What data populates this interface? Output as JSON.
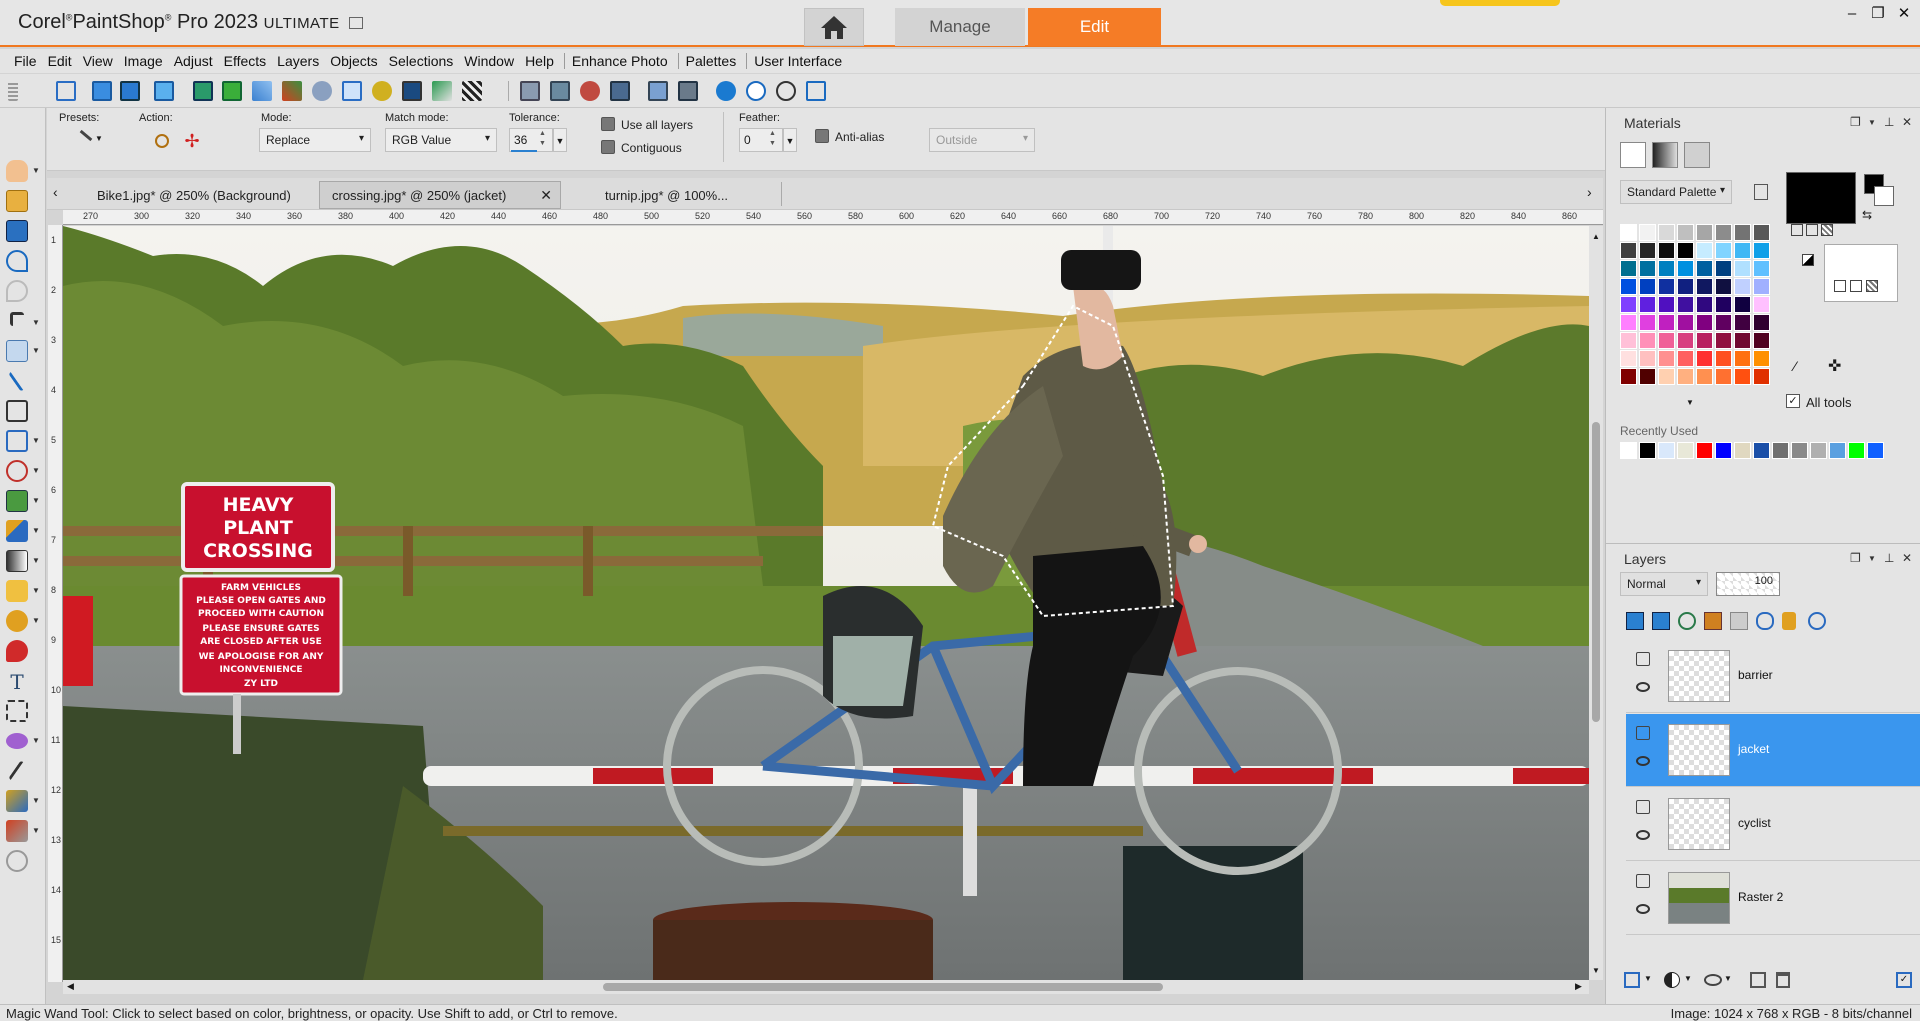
{
  "app": {
    "brand": "Corel",
    "name": "PaintShop",
    "name2": "Pro 2023",
    "edition": "ULTIMATE",
    "workspace_tabs": {
      "manage": "Manage",
      "edit": "Edit"
    }
  },
  "window_controls": {
    "minimize": "–",
    "restore": "❐",
    "close": "✕"
  },
  "menu": [
    "File",
    "Edit",
    "View",
    "Image",
    "Adjust",
    "Effects",
    "Layers",
    "Objects",
    "Selections",
    "Window",
    "Help"
  ],
  "menu_extra": [
    "Enhance Photo",
    "Palettes",
    "User Interface"
  ],
  "options": {
    "presets_label": "Presets:",
    "action_label": "Action:",
    "mode_label": "Mode:",
    "mode_value": "Replace",
    "match_mode_label": "Match mode:",
    "match_mode_value": "RGB Value",
    "tolerance_label": "Tolerance:",
    "tolerance_value": "36",
    "use_all_layers": "Use all layers",
    "contiguous": "Contiguous",
    "feather_label": "Feather:",
    "feather_value": "0",
    "anti_alias": "Anti-alias",
    "outside_value": "Outside"
  },
  "doc_tabs": [
    {
      "label": "Bike1.jpg* @ 250% (Background)"
    },
    {
      "label": "crossing.jpg* @ 250% (jacket)",
      "active": true
    },
    {
      "label": "turnip.jpg* @ 100%..."
    }
  ],
  "ruler_h": [
    "270",
    "300",
    "320",
    "340",
    "360",
    "380",
    "400",
    "420",
    "440",
    "460",
    "480",
    "500",
    "520",
    "540",
    "560",
    "580",
    "600",
    "620",
    "640",
    "660",
    "680",
    "700",
    "720",
    "740",
    "760",
    "780",
    "800",
    "820",
    "840",
    "860"
  ],
  "ruler_v": [
    "1",
    "2",
    "3",
    "4",
    "5",
    "6",
    "7",
    "8",
    "9",
    "10",
    "11",
    "12",
    "13",
    "14",
    "15"
  ],
  "canvas": {
    "sign1": [
      "HEAVY",
      "PLANT",
      "CROSSING"
    ],
    "sign2": [
      "FARM VEHICLES",
      "PLEASE OPEN GATES AND",
      "PROCEED WITH CAUTION",
      "PLEASE ENSURE GATES",
      "ARE CLOSED AFTER USE",
      "WE APOLOGISE FOR ANY",
      "INCONVENIENCE",
      "ZY LTD"
    ]
  },
  "materials": {
    "title": "Materials",
    "palette": "Standard Palette",
    "all_tools": "All tools",
    "recently_used_label": "Recently Used",
    "colors": {
      "foreground": "#000000",
      "background": "#ffffff"
    },
    "recent": [
      "#ffffff",
      "#000000",
      "#d9e8fb",
      "#e8e8d8",
      "#ff0000",
      "#0000ff",
      "#e0d8c0",
      "#1a4fa8",
      "#707070",
      "#8a8a8a",
      "#b0b0b0",
      "#5aa0e0",
      "#00ff00",
      "#1060ff"
    ],
    "swatch_rows": [
      [
        "#ffffff",
        "#f2f2f2",
        "#d9d9d9",
        "#bfbfbf",
        "#a6a6a6",
        "#8c8c8c",
        "#737373",
        "#595959"
      ],
      [
        "#404040",
        "#262626",
        "#0d0d0d",
        "#000000",
        "#c6ecff",
        "#80d4ff",
        "#40b8f5",
        "#10a0e8"
      ],
      [
        "#007090",
        "#0070a0",
        "#0080c0",
        "#0090e0",
        "#0060a0",
        "#004080",
        "#b0e0ff",
        "#60c0ff"
      ],
      [
        "#0050e0",
        "#0040c0",
        "#1030a0",
        "#102080",
        "#101860",
        "#101040",
        "#c0d0ff",
        "#a0b0ff"
      ],
      [
        "#8040ff",
        "#6020e0",
        "#5010c0",
        "#4010a0",
        "#300880",
        "#200060",
        "#100040",
        "#ffc0ff"
      ],
      [
        "#ff80ff",
        "#e040e0",
        "#c020c0",
        "#a010a0",
        "#800080",
        "#600060",
        "#400040",
        "#300030"
      ],
      [
        "#ffc0d8",
        "#ff90b8",
        "#f06098",
        "#d84080",
        "#b82060",
        "#901040",
        "#700830",
        "#500020"
      ],
      [
        "#ffe0e0",
        "#ffc0c0",
        "#ff9090",
        "#ff6060",
        "#ff3030",
        "#ff5020",
        "#ff7010",
        "#ff9000"
      ],
      [
        "#800000",
        "#500000",
        "#ffd0b0",
        "#ffb080",
        "#ff9050",
        "#ff7030",
        "#ff5010",
        "#e03000"
      ]
    ]
  },
  "layers": {
    "title": "Layers",
    "blend_mode": "Normal",
    "opacity": "100",
    "items": [
      {
        "name": "barrier"
      },
      {
        "name": "jacket",
        "selected": true
      },
      {
        "name": "cyclist"
      },
      {
        "name": "Raster 2"
      }
    ]
  },
  "status": {
    "hint": "Magic Wand Tool: Click to select based on color, brightness, or opacity. Use Shift to add, or Ctrl to remove.",
    "image_info": "Image:  1024 x 768 x RGB - 8 bits/channel"
  }
}
